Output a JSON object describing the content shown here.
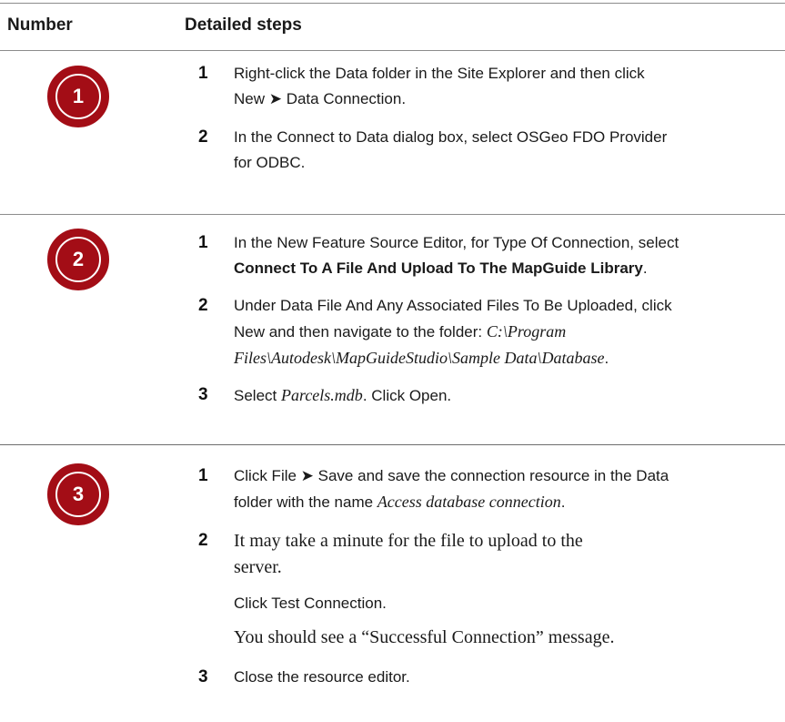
{
  "header": {
    "number_col": "Number",
    "steps_col": "Detailed steps"
  },
  "colors": {
    "badge": "#a30d16",
    "rule": "#8c8c8c"
  },
  "sections": [
    {
      "badge": "1",
      "steps": [
        {
          "n": "1",
          "a": "Right-click the Data folder in the Site Explorer and then click",
          "b": "New ➤ Data Connection."
        },
        {
          "n": "2",
          "a": "In the Connect to Data dialog box, select OSGeo FDO Provider",
          "b": "for ODBC."
        }
      ]
    },
    {
      "badge": "2",
      "steps": [
        {
          "n": "1",
          "a": "In the New Feature Source Editor, for Type Of Connection, select",
          "b_bold": "Connect To A File And Upload To The MapGuide Library",
          "b_tail": "."
        },
        {
          "n": "2",
          "a": "Under Data File And Any Associated Files To Be Uploaded, click",
          "b": "New and then navigate to the folder: ",
          "b_italic": "C:\\Program",
          "c_italic": "Files\\Autodesk\\MapGuideStudio\\Sample Data\\Database",
          "c_tail": "."
        },
        {
          "n": "3",
          "a": "Select ",
          "a_italic": "Parcels.mdb",
          "a_tail": ". Click Open."
        }
      ]
    },
    {
      "badge": "3",
      "steps": [
        {
          "n": "1",
          "a": "Click File ➤ Save and save the connection resource in the Data",
          "b": "folder with the name ",
          "b_italic": "Access database connection",
          "b_tail": "."
        },
        {
          "n": "2",
          "a": "It may take a minute for the file to upload to the",
          "b": "server.",
          "c": "Click Test Connection.",
          "d": "You should see a “Successful Connection” message."
        },
        {
          "n": "3",
          "a": "Close the resource editor."
        }
      ]
    }
  ]
}
